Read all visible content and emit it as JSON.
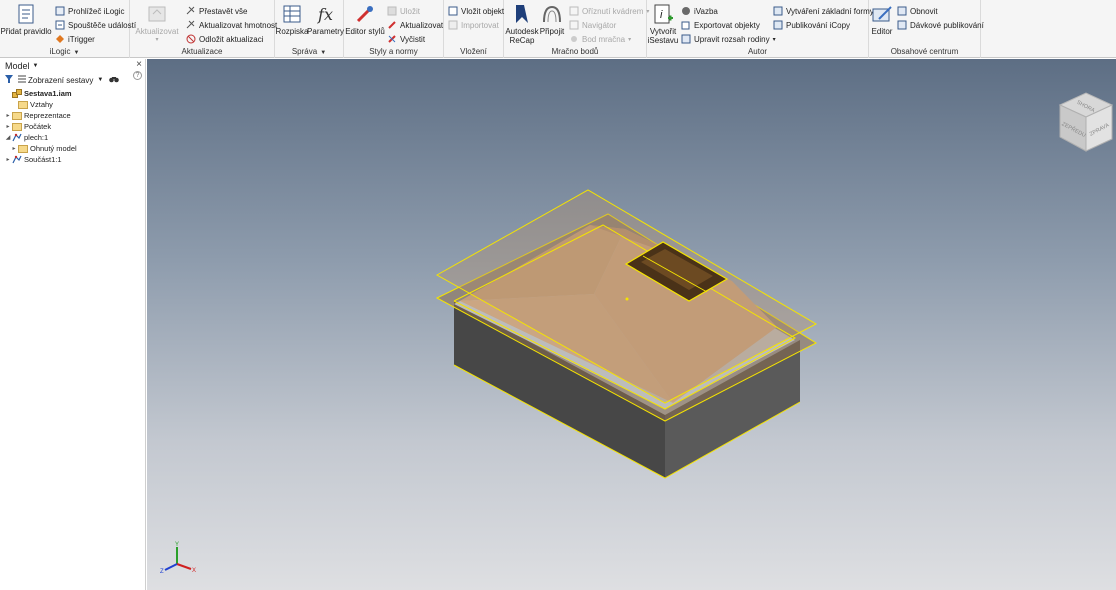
{
  "ribbon": {
    "ilogic": {
      "title": "iLogic",
      "add_rule": "Přidat pravidlo",
      "browser": "Prohlížeč iLogic",
      "triggers": "Spouštěče událostí",
      "itrigger": "iTrigger"
    },
    "update": {
      "title": "Aktualizace",
      "update_btn": "Aktualizovat",
      "rebuild_all": "Přestavět vše",
      "update_mass": "Aktualizovat hmotnost",
      "defer_update": "Odložit aktualizaci"
    },
    "manage": {
      "title": "Správa",
      "bom": "Rozpiska",
      "params": "Parametry"
    },
    "styles": {
      "title": "Styly a normy",
      "editor": "Editor stylů",
      "save": "Uložit",
      "update": "Aktualizovat",
      "purge": "Vyčistit"
    },
    "insert": {
      "title": "Vložení",
      "insert_object": "Vložit objekt",
      "import": "Importovat"
    },
    "pointcloud": {
      "title": "Mračno bodů",
      "recap_line1": "Autodesk",
      "recap_line2": "ReCap",
      "attach": "Připojit",
      "crop_box": "Oříznutí kvádrem",
      "navigator": "Navigátor",
      "cloud_point": "Bod mračna"
    },
    "author": {
      "title": "Autor",
      "create_line1": "Vytvořit",
      "create_line2": "iSestavu",
      "constraint": "iVazba",
      "export_objects": "Exportovat objekty",
      "edit_family": "Upravit rozsah rodiny",
      "base_form": "Vytváření základní formy",
      "publish_icopy": "Publikování iCopy"
    },
    "content": {
      "title": "Obsahové centrum",
      "editor": "Editor",
      "refresh": "Obnovit",
      "batch_publish": "Dávkové publikování"
    }
  },
  "panel": {
    "title": "Model",
    "view_label": "Zobrazení sestavy",
    "tree": [
      {
        "label": "Sestava1.iam",
        "level": 0,
        "expander": "",
        "icon": "assembly-icon"
      },
      {
        "label": "Vztahy",
        "level": 1,
        "expander": "",
        "icon": "folder-icon"
      },
      {
        "label": "Reprezentace",
        "level": 0,
        "expander": "▸",
        "icon": "folder-icon"
      },
      {
        "label": "Počátek",
        "level": 0,
        "expander": "▸",
        "icon": "folder-icon"
      },
      {
        "label": "plech:1",
        "level": 0,
        "expander": "◢",
        "icon": "part-icon"
      },
      {
        "label": "Ohnutý model",
        "level": 1,
        "expander": "▸",
        "icon": "folder-icon"
      },
      {
        "label": "Součást1:1",
        "level": 0,
        "expander": "▸",
        "icon": "part-icon"
      }
    ]
  },
  "viewcube": {
    "top": "SHORA",
    "front": "ZEPŘEDU",
    "right": "ZPRAVA"
  },
  "triad": {
    "x": "X",
    "y": "Y",
    "z": "Z"
  },
  "colors": {
    "ribbon_bg": "#f5f5f5",
    "viewport_top": "#5d6e84",
    "viewport_bottom": "#dedfe2",
    "edge_highlight": "#f5e400",
    "block_dark": "#4c4c4c",
    "roof": "#c8a27c"
  }
}
